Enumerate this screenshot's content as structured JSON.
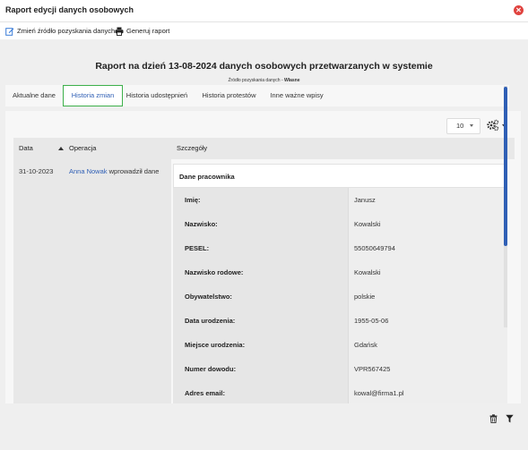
{
  "window": {
    "title": "Raport edycji danych osobowych",
    "close_icon": "close-circle-icon",
    "close_color": "#e0433f"
  },
  "toolbar": {
    "change_source_label": "Zmień źródło pozyskania danych",
    "change_source_icon": "edit-icon",
    "generate_label": "Generuj raport",
    "generate_icon": "print-icon"
  },
  "report": {
    "title": "Raport na dzień 13-08-2024 danych osobowych przetwarzanych w systemie",
    "source_label": "Źródło pozyskania danych - ",
    "source_value": "Własne"
  },
  "tabs": [
    {
      "label": "Aktualne dane",
      "active": false
    },
    {
      "label": "Historia zmian",
      "active": true
    },
    {
      "label": "Historia udostępnień",
      "active": false
    },
    {
      "label": "Historia protestów",
      "active": false
    },
    {
      "label": "Inne ważne wpisy",
      "active": false
    }
  ],
  "table_controls": {
    "page_size": "10",
    "settings_icon": "gears-icon"
  },
  "table": {
    "headers": {
      "date": "Data",
      "operation": "Operacja",
      "details": "Szczegóły"
    },
    "row": {
      "date": "31-10-2023",
      "operation_user": "Anna Nowak",
      "operation_text": " wprowadził dane"
    }
  },
  "details": {
    "section_title": "Dane pracownika",
    "fields": [
      {
        "label": "Imię:",
        "value": "Janusz"
      },
      {
        "label": "Nazwisko:",
        "value": "Kowalski"
      },
      {
        "label": "PESEL:",
        "value": "55050649794"
      },
      {
        "label": "Nazwisko rodowe:",
        "value": "Kowalski"
      },
      {
        "label": "Obywatelstwo:",
        "value": "polskie"
      },
      {
        "label": "Data urodzenia:",
        "value": "1955-05-06"
      },
      {
        "label": "Miejsce urodzenia:",
        "value": "Gdańsk"
      },
      {
        "label": "Numer dowodu:",
        "value": "VPR567425"
      },
      {
        "label": "Adres email:",
        "value": "kowal@firma1.pl"
      }
    ]
  },
  "footer_icons": [
    "trash-icon",
    "filter-icon"
  ],
  "colors": {
    "active_tab_border": "#3db04a",
    "link": "#2f5fb5",
    "scrollbar": "#2f5fb5"
  }
}
